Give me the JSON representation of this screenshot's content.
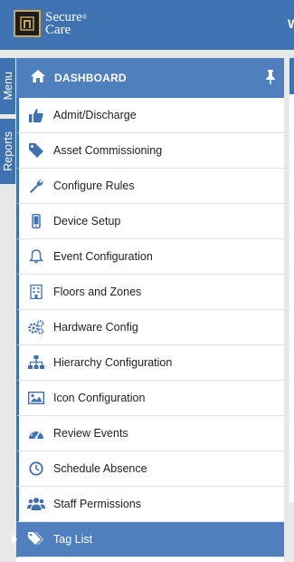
{
  "app": {
    "logo_line1": "Secure",
    "logo_line2": "Care",
    "header_cut": "W"
  },
  "side_tabs": {
    "menu": "Menu",
    "reports": "Reports"
  },
  "panel": {
    "title": "DASHBOARD"
  },
  "menu_items": [
    {
      "label": "Admit/Discharge",
      "icon": "thumbs-up-icon"
    },
    {
      "label": "Asset Commissioning",
      "icon": "tag-icon"
    },
    {
      "label": "Configure Rules",
      "icon": "wrench-icon"
    },
    {
      "label": "Device Setup",
      "icon": "mobile-icon"
    },
    {
      "label": "Event Configuration",
      "icon": "bell-icon"
    },
    {
      "label": "Floors and Zones",
      "icon": "building-icon"
    },
    {
      "label": "Hardware Config",
      "icon": "gears-icon"
    },
    {
      "label": "Hierarchy Configuration",
      "icon": "sitemap-icon"
    },
    {
      "label": "Icon Configuration",
      "icon": "image-icon"
    },
    {
      "label": "Review Events",
      "icon": "dashboard-icon"
    },
    {
      "label": "Schedule Absence",
      "icon": "clock-icon"
    },
    {
      "label": "Staff Permissions",
      "icon": "users-icon"
    },
    {
      "label": "Tag List",
      "icon": "tags-icon",
      "active": true
    }
  ],
  "colors": {
    "brand_blue": "#3f72b0",
    "active_blue": "#4f7fbd",
    "icon_blue": "#3f72b0"
  }
}
